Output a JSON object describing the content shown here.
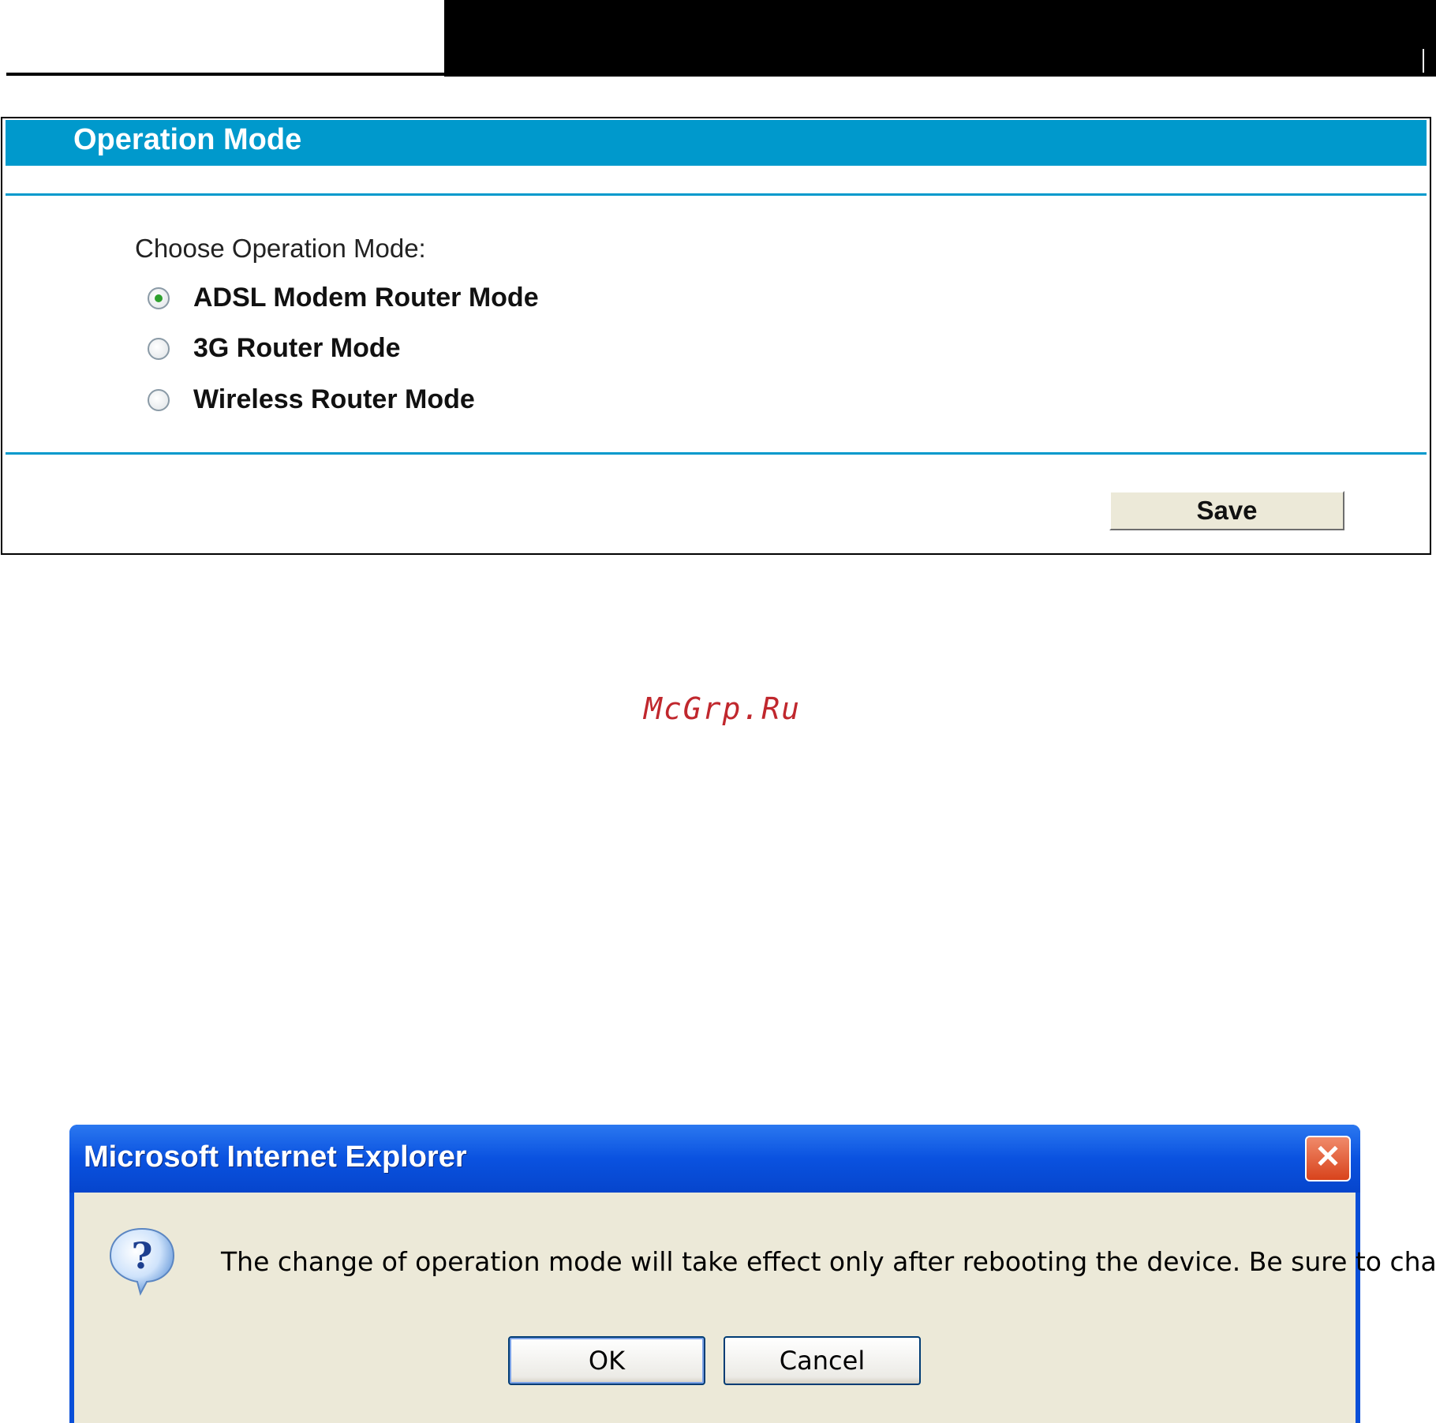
{
  "panel": {
    "title": "Operation Mode",
    "choose_label": "Choose Operation Mode:",
    "options": [
      {
        "label": "ADSL Modem Router Mode",
        "selected": true
      },
      {
        "label": "3G Router Mode",
        "selected": false
      },
      {
        "label": "Wireless Router Mode",
        "selected": false
      }
    ],
    "save_label": "Save"
  },
  "watermark": "McGrp.Ru",
  "dialog": {
    "title": "Microsoft Internet Explorer",
    "close_glyph": "✕",
    "message": "The change of operation mode will take effect only after rebooting the device. Be sure to change?",
    "ok_label": "OK",
    "cancel_label": "Cancel"
  },
  "colors": {
    "panel_accent": "#0099cc",
    "dialog_titlebar": "#0a52e0",
    "dialog_body": "#ece9d8",
    "watermark": "#c0272d"
  }
}
